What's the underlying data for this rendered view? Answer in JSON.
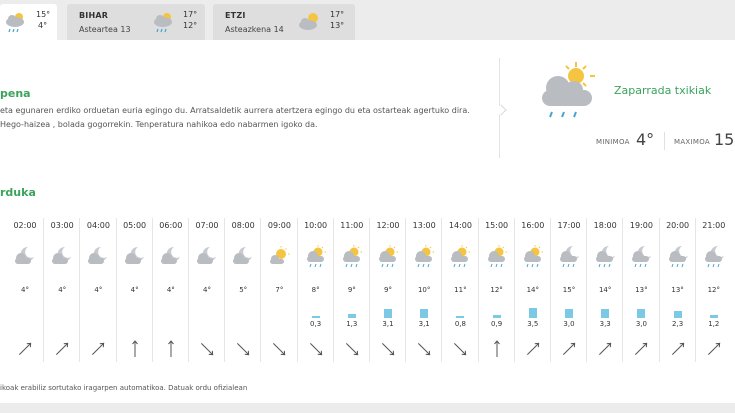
{
  "tabs": [
    {
      "name": "",
      "date": "",
      "hi": "15°",
      "lo": "4°",
      "icon": "rain-cloud-icon"
    },
    {
      "name": "BIHAR",
      "date": "Asteartea 13",
      "hi": "17°",
      "lo": "12°",
      "icon": "rain-cloud-icon"
    },
    {
      "name": "ETZI",
      "date": "Asteazkena 14",
      "hi": "17°",
      "lo": "13°",
      "icon": "sun-cloud-icon"
    }
  ],
  "summary": {
    "title": "pena",
    "text": "eta egunaren erdiko orduetan euria egingo du. Arratsaldetik aurrera atertzera egingo du eta ostarteak agertuko dira. Hego-haizea , bolada gogorrekin. Tenperatura nahikoa edo nabarmen igoko da.",
    "condition": "Zaparrada txikiak",
    "min_label": "MINIMOA",
    "min_value": "4°",
    "max_label": "MAXIMOA",
    "max_value": "15°",
    "icon": "sun-cloud-rain-icon"
  },
  "hourly": {
    "title": "rduka",
    "hours": [
      {
        "time": "02:00",
        "temp": "4°",
        "rain": "",
        "rain_mm": 0,
        "icon": "moon-cloud-icon",
        "wind_dir": 45
      },
      {
        "time": "03:00",
        "temp": "4°",
        "rain": "",
        "rain_mm": 0,
        "icon": "moon-cloud-icon",
        "wind_dir": 45
      },
      {
        "time": "04:00",
        "temp": "4°",
        "rain": "",
        "rain_mm": 0,
        "icon": "moon-cloud-icon",
        "wind_dir": 45
      },
      {
        "time": "05:00",
        "temp": "4°",
        "rain": "",
        "rain_mm": 0,
        "icon": "moon-cloud-icon",
        "wind_dir": 0
      },
      {
        "time": "06:00",
        "temp": "4°",
        "rain": "",
        "rain_mm": 0,
        "icon": "moon-cloud-icon",
        "wind_dir": 0
      },
      {
        "time": "07:00",
        "temp": "4°",
        "rain": "",
        "rain_mm": 0,
        "icon": "moon-cloud-icon",
        "wind_dir": 135
      },
      {
        "time": "08:00",
        "temp": "5°",
        "rain": "",
        "rain_mm": 0,
        "icon": "moon-cloud-icon",
        "wind_dir": 135
      },
      {
        "time": "09:00",
        "temp": "7°",
        "rain": "",
        "rain_mm": 0,
        "icon": "sun-cloud-icon",
        "wind_dir": 135
      },
      {
        "time": "10:00",
        "temp": "8°",
        "rain": "0,3",
        "rain_mm": 0.3,
        "icon": "sun-cloud-rain-icon",
        "wind_dir": 135
      },
      {
        "time": "11:00",
        "temp": "9°",
        "rain": "1,3",
        "rain_mm": 1.3,
        "icon": "sun-cloud-rain-icon",
        "wind_dir": 135
      },
      {
        "time": "12:00",
        "temp": "9°",
        "rain": "3,1",
        "rain_mm": 3.1,
        "icon": "sun-cloud-rain-icon",
        "wind_dir": 135
      },
      {
        "time": "13:00",
        "temp": "10°",
        "rain": "3,1",
        "rain_mm": 3.1,
        "icon": "sun-cloud-rain-icon",
        "wind_dir": 135
      },
      {
        "time": "14:00",
        "temp": "11°",
        "rain": "0,8",
        "rain_mm": 0.8,
        "icon": "sun-cloud-rain-icon",
        "wind_dir": 135
      },
      {
        "time": "15:00",
        "temp": "12°",
        "rain": "0,9",
        "rain_mm": 0.9,
        "icon": "sun-cloud-rain-icon",
        "wind_dir": 0
      },
      {
        "time": "16:00",
        "temp": "14°",
        "rain": "3,5",
        "rain_mm": 3.5,
        "icon": "sun-cloud-rain-icon",
        "wind_dir": 45
      },
      {
        "time": "17:00",
        "temp": "15°",
        "rain": "3,0",
        "rain_mm": 3.0,
        "icon": "moon-cloud-rain-icon",
        "wind_dir": 45
      },
      {
        "time": "18:00",
        "temp": "14°",
        "rain": "3,3",
        "rain_mm": 3.3,
        "icon": "moon-cloud-rain-icon",
        "wind_dir": 45
      },
      {
        "time": "19:00",
        "temp": "13°",
        "rain": "3,0",
        "rain_mm": 3.0,
        "icon": "moon-cloud-rain-icon",
        "wind_dir": 45
      },
      {
        "time": "20:00",
        "temp": "13°",
        "rain": "2,3",
        "rain_mm": 2.3,
        "icon": "moon-cloud-rain-icon",
        "wind_dir": 45
      },
      {
        "time": "21:00",
        "temp": "12°",
        "rain": "1,2",
        "rain_mm": 1.2,
        "icon": "moon-cloud-rain-icon",
        "wind_dir": 45
      }
    ]
  },
  "footnote": "ikoak erabiliz sortutako iragarpen automatikoa. Datuak ordu ofizialean",
  "colors": {
    "accent": "#3aa35c",
    "rain_bar": "#7cc9e5",
    "sun": "#f5c542",
    "cloud": "#b9bcc0",
    "moon": "#c7cace"
  }
}
